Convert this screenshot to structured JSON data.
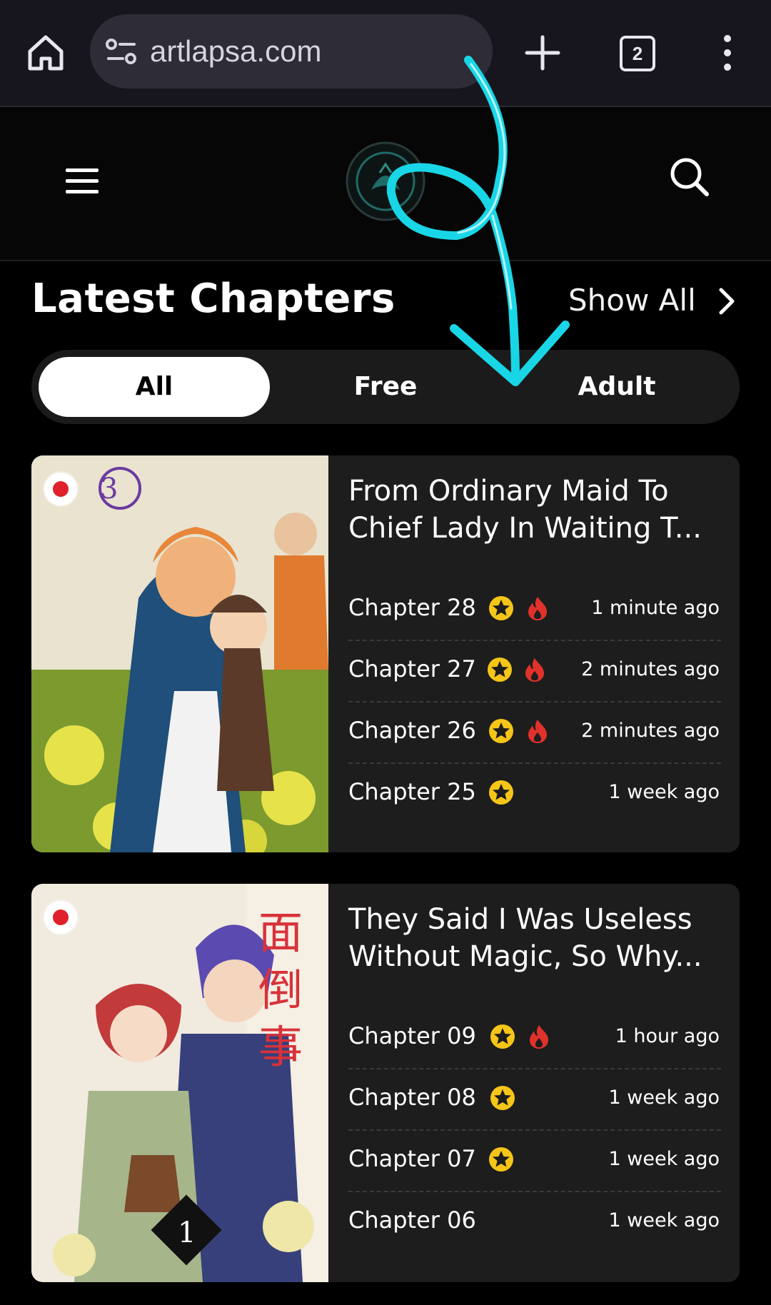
{
  "browser": {
    "url": "artlapsa.com",
    "tab_count": "2"
  },
  "site": {
    "logo_name": "artlapsa-logo"
  },
  "section": {
    "title": "Latest Chapters",
    "show_all": "Show All"
  },
  "filters": [
    {
      "label": "All",
      "active": true
    },
    {
      "label": "Free",
      "active": false
    },
    {
      "label": "Adult",
      "active": false
    }
  ],
  "cards": [
    {
      "title": "From Ordinary Maid To Chief Lady In Waiting T...",
      "chapters": [
        {
          "name": "Chapter 28",
          "time": "1 minute ago",
          "hot": true
        },
        {
          "name": "Chapter 27",
          "time": "2 minutes ago",
          "hot": true
        },
        {
          "name": "Chapter 26",
          "time": "2 minutes ago",
          "hot": true
        },
        {
          "name": "Chapter 25",
          "time": "1 week ago",
          "hot": false
        }
      ]
    },
    {
      "title": "They Said I Was Useless Without Magic, So Why...",
      "chapters": [
        {
          "name": "Chapter 09",
          "time": "1 hour ago",
          "hot": true
        },
        {
          "name": "Chapter 08",
          "time": "1 week ago",
          "hot": false
        },
        {
          "name": "Chapter 07",
          "time": "1 week ago",
          "hot": false
        },
        {
          "name": "Chapter 06",
          "time": "1 week ago",
          "hot": false
        }
      ]
    }
  ],
  "colors": {
    "accent_star": "#f5c518",
    "accent_fire": "#e0322b",
    "annotation": "#19d6e6"
  }
}
